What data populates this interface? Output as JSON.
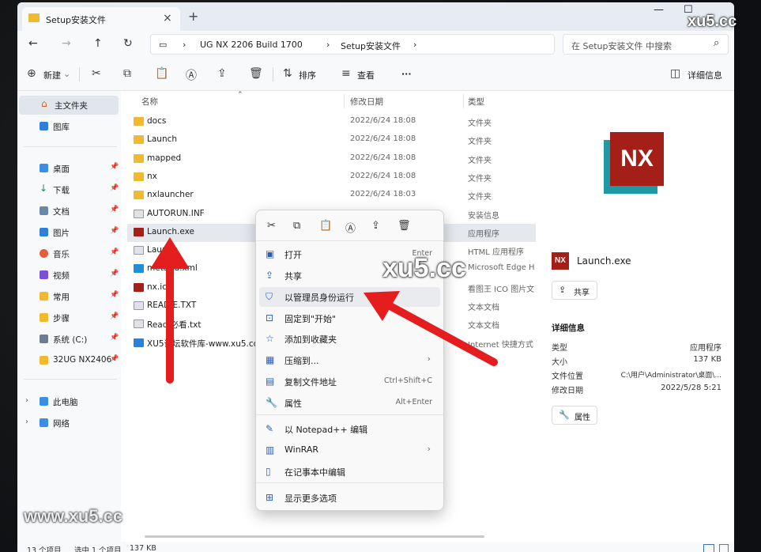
{
  "tab": {
    "title": "Setup安装文件"
  },
  "address": {
    "crumbs": [
      "UG NX 2206 Build 1700",
      "Setup安装文件"
    ],
    "search_placeholder": "在 Setup安装文件 中搜索"
  },
  "toolbar": {
    "new": "新建",
    "sort": "排序",
    "view": "查看",
    "details": "详细信息"
  },
  "sidebar": {
    "home": "主文件夹",
    "gallery": "图库",
    "pinned": [
      "桌面",
      "下载",
      "文档",
      "图片",
      "音乐",
      "视频",
      "常用",
      "步骤",
      "系统 (C:)",
      "32UG NX2406"
    ],
    "thispc": "此电脑",
    "network": "网络"
  },
  "columns": {
    "name": "名称",
    "date": "修改日期",
    "type": "类型"
  },
  "files": [
    {
      "name": "docs",
      "date": "2022/6/24 18:08",
      "type": "文件夹",
      "icon": "folder-icon"
    },
    {
      "name": "Launch",
      "date": "2022/6/24 18:08",
      "type": "文件夹",
      "icon": "folder-icon"
    },
    {
      "name": "mapped",
      "date": "2022/6/24 18:08",
      "type": "文件夹",
      "icon": "folder-icon"
    },
    {
      "name": "nx",
      "date": "2022/6/24 18:08",
      "type": "文件夹",
      "icon": "folder-icon"
    },
    {
      "name": "nxlauncher",
      "date": "2022/6/24 18:03",
      "type": "文件夹",
      "icon": "folder-icon"
    },
    {
      "name": "AUTORUN.INF",
      "date": "",
      "type": "安装信息",
      "icon": "file-icon"
    },
    {
      "name": "Launch.exe",
      "date": "",
      "type": "应用程序",
      "icon": "nx-icon"
    },
    {
      "name": "Laun      ta",
      "date": "",
      "type": "HTML 应用程序",
      "icon": "file-icon"
    },
    {
      "name": "meta    ta.xml",
      "date": "",
      "type": "Microsoft Edge H",
      "icon": "edge-icon"
    },
    {
      "name": "nx.ico",
      "date": "",
      "type": "看图王 ICO 图片文",
      "icon": "nx-icon"
    },
    {
      "name": "READ   E.TXT",
      "date": "",
      "type": "文本文档",
      "icon": "file-icon"
    },
    {
      "name": "Read   必看.txt",
      "date": "",
      "type": "文本文档",
      "icon": "file-icon"
    },
    {
      "name": "XU5论坛软件库-www.xu5.cc安",
      "date": "",
      "type": "Internet 快捷方式",
      "icon": "link-icon"
    }
  ],
  "details": {
    "filename": "Launch.exe",
    "share": "共享",
    "heading": "详细信息",
    "props": [
      {
        "k": "类型",
        "v": "应用程序"
      },
      {
        "k": "大小",
        "v": "137 KB"
      },
      {
        "k": "文件位置",
        "v": "C:\\用户\\Administrator\\桌面\\..."
      },
      {
        "k": "修改日期",
        "v": "2022/5/28 5:21"
      }
    ],
    "properties": "属性",
    "logo_text": "NX"
  },
  "menu": [
    {
      "label": "打开",
      "shortcut": "Enter",
      "icon": "open-icon"
    },
    {
      "label": "共享",
      "shortcut": "",
      "icon": "share-icon"
    },
    {
      "label": "以管理员身份运行",
      "shortcut": "",
      "icon": "shield-icon"
    },
    {
      "label": "固定到\"开始\"",
      "shortcut": "",
      "icon": "pin-icon"
    },
    {
      "label": "添加到收藏夹",
      "shortcut": "",
      "icon": "star-icon"
    },
    {
      "label": "压缩到...",
      "shortcut": "",
      "icon": "zip-icon",
      "submenu": true
    },
    {
      "label": "复制文件地址",
      "shortcut": "Ctrl+Shift+C",
      "icon": "copy-path-icon"
    },
    {
      "label": "属性",
      "shortcut": "Alt+Enter",
      "icon": "wrench-icon"
    },
    {
      "label": "以 Notepad++ 编辑",
      "shortcut": "",
      "icon": "notepadpp-icon"
    },
    {
      "label": "WinRAR",
      "shortcut": "",
      "icon": "winrar-icon",
      "submenu": true
    },
    {
      "label": "在记事本中编辑",
      "shortcut": "",
      "icon": "notepad-icon"
    },
    {
      "label": "显示更多选项",
      "shortcut": "",
      "icon": "more-options-icon"
    }
  ],
  "status": {
    "count": "13 个项目",
    "selected": "选中 1 个项目",
    "size": "137 KB"
  },
  "watermarks": {
    "top": "xu5.cc",
    "mid": "xu5.cc",
    "bottom": "www.xu5.cc"
  }
}
